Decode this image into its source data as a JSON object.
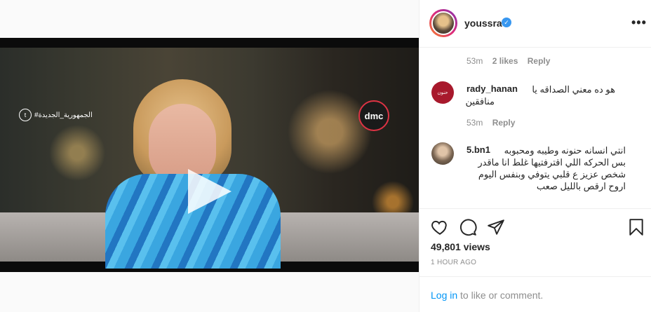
{
  "video": {
    "hashtag": "#الجمهورية_الجديدة",
    "channel_logo": "dmc"
  },
  "post": {
    "username": "youssra",
    "verified": true,
    "views": "49,801 views",
    "time": "1 HOUR AGO",
    "login_link": "Log in",
    "login_suffix": " to like or comment."
  },
  "comments": [
    {
      "meta_time": "53m",
      "likes": "2 likes",
      "reply": "Reply"
    },
    {
      "username": "rady_hanan",
      "line1": "هو ده معني الصداقه يا",
      "line2": "منافقين",
      "meta_time": "53m",
      "reply": "Reply",
      "avatar_text": "حنون"
    },
    {
      "username": "5.bn1",
      "line1": "انتي انسانه حنونه وطيبه ومحبوبه",
      "line2": "بس الحركه اللي اقترفتيها غلط انا ماقدر",
      "line3": "شخص عزيز ع قلبي يتوفي وبنفس اليوم",
      "line4": "اروح ارقص بالليل صعب"
    }
  ],
  "icons": [
    "heart-icon",
    "comment-icon",
    "share-icon",
    "bookmark-icon",
    "more-icon",
    "verified-icon",
    "play-icon",
    "twitter-icon"
  ],
  "colors": {
    "link": "#0095f6",
    "verified": "#3897f0",
    "muted": "#8e8e8e"
  }
}
